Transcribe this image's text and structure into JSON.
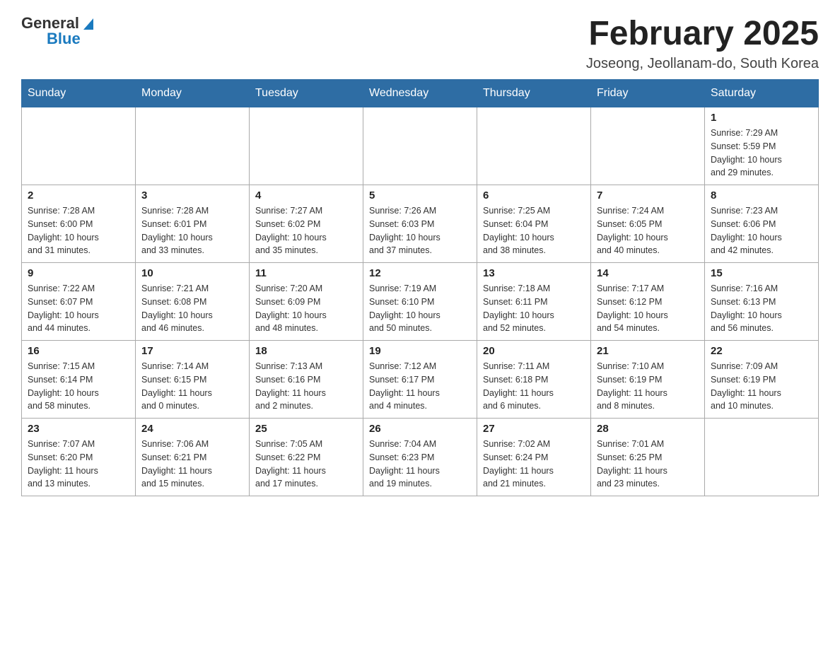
{
  "header": {
    "logo_general": "General",
    "logo_blue": "Blue",
    "title": "February 2025",
    "subtitle": "Joseong, Jeollanam-do, South Korea"
  },
  "days_of_week": [
    "Sunday",
    "Monday",
    "Tuesday",
    "Wednesday",
    "Thursday",
    "Friday",
    "Saturday"
  ],
  "weeks": [
    [
      {
        "day": "",
        "info": ""
      },
      {
        "day": "",
        "info": ""
      },
      {
        "day": "",
        "info": ""
      },
      {
        "day": "",
        "info": ""
      },
      {
        "day": "",
        "info": ""
      },
      {
        "day": "",
        "info": ""
      },
      {
        "day": "1",
        "info": "Sunrise: 7:29 AM\nSunset: 5:59 PM\nDaylight: 10 hours\nand 29 minutes."
      }
    ],
    [
      {
        "day": "2",
        "info": "Sunrise: 7:28 AM\nSunset: 6:00 PM\nDaylight: 10 hours\nand 31 minutes."
      },
      {
        "day": "3",
        "info": "Sunrise: 7:28 AM\nSunset: 6:01 PM\nDaylight: 10 hours\nand 33 minutes."
      },
      {
        "day": "4",
        "info": "Sunrise: 7:27 AM\nSunset: 6:02 PM\nDaylight: 10 hours\nand 35 minutes."
      },
      {
        "day": "5",
        "info": "Sunrise: 7:26 AM\nSunset: 6:03 PM\nDaylight: 10 hours\nand 37 minutes."
      },
      {
        "day": "6",
        "info": "Sunrise: 7:25 AM\nSunset: 6:04 PM\nDaylight: 10 hours\nand 38 minutes."
      },
      {
        "day": "7",
        "info": "Sunrise: 7:24 AM\nSunset: 6:05 PM\nDaylight: 10 hours\nand 40 minutes."
      },
      {
        "day": "8",
        "info": "Sunrise: 7:23 AM\nSunset: 6:06 PM\nDaylight: 10 hours\nand 42 minutes."
      }
    ],
    [
      {
        "day": "9",
        "info": "Sunrise: 7:22 AM\nSunset: 6:07 PM\nDaylight: 10 hours\nand 44 minutes."
      },
      {
        "day": "10",
        "info": "Sunrise: 7:21 AM\nSunset: 6:08 PM\nDaylight: 10 hours\nand 46 minutes."
      },
      {
        "day": "11",
        "info": "Sunrise: 7:20 AM\nSunset: 6:09 PM\nDaylight: 10 hours\nand 48 minutes."
      },
      {
        "day": "12",
        "info": "Sunrise: 7:19 AM\nSunset: 6:10 PM\nDaylight: 10 hours\nand 50 minutes."
      },
      {
        "day": "13",
        "info": "Sunrise: 7:18 AM\nSunset: 6:11 PM\nDaylight: 10 hours\nand 52 minutes."
      },
      {
        "day": "14",
        "info": "Sunrise: 7:17 AM\nSunset: 6:12 PM\nDaylight: 10 hours\nand 54 minutes."
      },
      {
        "day": "15",
        "info": "Sunrise: 7:16 AM\nSunset: 6:13 PM\nDaylight: 10 hours\nand 56 minutes."
      }
    ],
    [
      {
        "day": "16",
        "info": "Sunrise: 7:15 AM\nSunset: 6:14 PM\nDaylight: 10 hours\nand 58 minutes."
      },
      {
        "day": "17",
        "info": "Sunrise: 7:14 AM\nSunset: 6:15 PM\nDaylight: 11 hours\nand 0 minutes."
      },
      {
        "day": "18",
        "info": "Sunrise: 7:13 AM\nSunset: 6:16 PM\nDaylight: 11 hours\nand 2 minutes."
      },
      {
        "day": "19",
        "info": "Sunrise: 7:12 AM\nSunset: 6:17 PM\nDaylight: 11 hours\nand 4 minutes."
      },
      {
        "day": "20",
        "info": "Sunrise: 7:11 AM\nSunset: 6:18 PM\nDaylight: 11 hours\nand 6 minutes."
      },
      {
        "day": "21",
        "info": "Sunrise: 7:10 AM\nSunset: 6:19 PM\nDaylight: 11 hours\nand 8 minutes."
      },
      {
        "day": "22",
        "info": "Sunrise: 7:09 AM\nSunset: 6:19 PM\nDaylight: 11 hours\nand 10 minutes."
      }
    ],
    [
      {
        "day": "23",
        "info": "Sunrise: 7:07 AM\nSunset: 6:20 PM\nDaylight: 11 hours\nand 13 minutes."
      },
      {
        "day": "24",
        "info": "Sunrise: 7:06 AM\nSunset: 6:21 PM\nDaylight: 11 hours\nand 15 minutes."
      },
      {
        "day": "25",
        "info": "Sunrise: 7:05 AM\nSunset: 6:22 PM\nDaylight: 11 hours\nand 17 minutes."
      },
      {
        "day": "26",
        "info": "Sunrise: 7:04 AM\nSunset: 6:23 PM\nDaylight: 11 hours\nand 19 minutes."
      },
      {
        "day": "27",
        "info": "Sunrise: 7:02 AM\nSunset: 6:24 PM\nDaylight: 11 hours\nand 21 minutes."
      },
      {
        "day": "28",
        "info": "Sunrise: 7:01 AM\nSunset: 6:25 PM\nDaylight: 11 hours\nand 23 minutes."
      },
      {
        "day": "",
        "info": ""
      }
    ]
  ]
}
